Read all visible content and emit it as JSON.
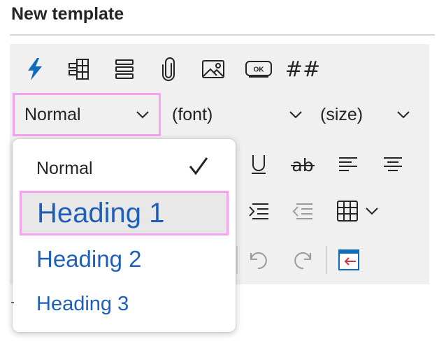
{
  "header": {
    "title": "New template"
  },
  "toolbar": {
    "row1": [
      {
        "name": "lightning-icon"
      },
      {
        "name": "table-grid-icon"
      },
      {
        "name": "stacked-rows-icon"
      },
      {
        "name": "paperclip-icon"
      },
      {
        "name": "image-icon"
      },
      {
        "name": "ok-button-icon",
        "text": "OK"
      },
      {
        "name": "hash-icon",
        "text": "##"
      }
    ],
    "style_select": {
      "value": "Normal"
    },
    "font_select": {
      "value": "(font)"
    },
    "size_select": {
      "value": "(size)"
    }
  },
  "style_menu": {
    "items": [
      {
        "label": "Normal",
        "selected": true
      },
      {
        "label": "Heading 1",
        "highlighted": true
      },
      {
        "label": "Heading 2"
      },
      {
        "label": "Heading 3"
      }
    ]
  },
  "colors": {
    "accent": "#1f5fb8",
    "lightning": "#0f6cbd",
    "highlight_border": "#f5a2ef",
    "toolbar_bg": "#f0f0f0",
    "arrow_red": "#d13438"
  }
}
